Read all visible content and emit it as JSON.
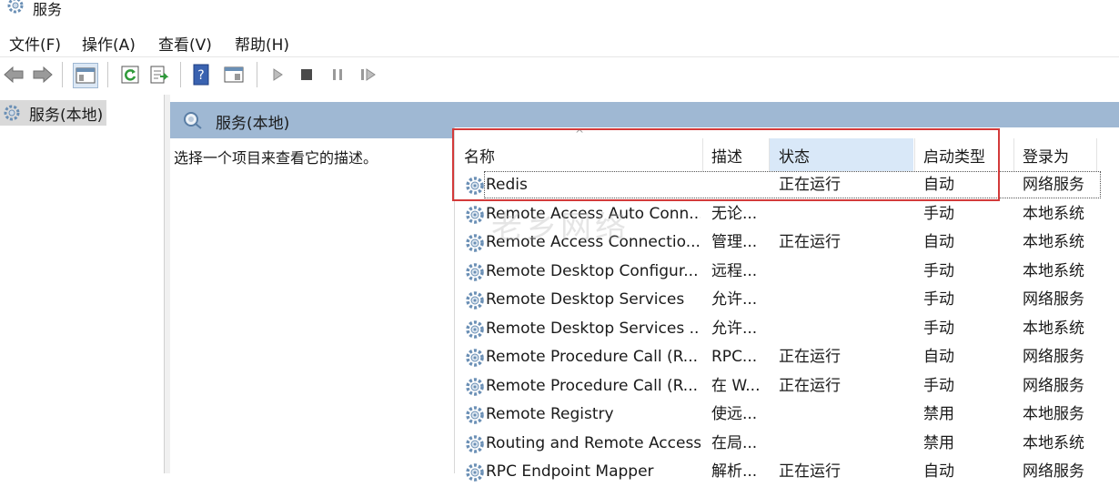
{
  "window": {
    "title": "服务"
  },
  "menu": {
    "items": [
      "文件(F)",
      "操作(A)",
      "查看(V)",
      "帮助(H)"
    ]
  },
  "tree": {
    "item_label": "服务(本地)"
  },
  "panel": {
    "header": "服务(本地)",
    "description": "选择一个项目来查看它的描述。"
  },
  "columns": {
    "name": "名称",
    "desc": "描述",
    "status": "状态",
    "startup": "启动类型",
    "logon": "登录为"
  },
  "rows": [
    {
      "name": "Redis",
      "desc": "",
      "status": "正在运行",
      "startup": "自动",
      "logon": "网络服务"
    },
    {
      "name": "Remote Access Auto Conn...",
      "desc": "无论...",
      "status": "",
      "startup": "手动",
      "logon": "本地系统"
    },
    {
      "name": "Remote Access Connectio...",
      "desc": "管理...",
      "status": "正在运行",
      "startup": "自动",
      "logon": "本地系统"
    },
    {
      "name": "Remote Desktop Configur...",
      "desc": "远程...",
      "status": "",
      "startup": "手动",
      "logon": "本地系统"
    },
    {
      "name": "Remote Desktop Services",
      "desc": "允许...",
      "status": "",
      "startup": "手动",
      "logon": "网络服务"
    },
    {
      "name": "Remote Desktop Services ...",
      "desc": "允许...",
      "status": "",
      "startup": "手动",
      "logon": "本地系统"
    },
    {
      "name": "Remote Procedure Call (R...",
      "desc": "RPC...",
      "status": "正在运行",
      "startup": "自动",
      "logon": "网络服务"
    },
    {
      "name": "Remote Procedure Call (R...",
      "desc": "在 W...",
      "status": "正在运行",
      "startup": "手动",
      "logon": "网络服务"
    },
    {
      "name": "Remote Registry",
      "desc": "使远...",
      "status": "",
      "startup": "禁用",
      "logon": "本地服务"
    },
    {
      "name": "Routing and Remote Access",
      "desc": "在局...",
      "status": "",
      "startup": "禁用",
      "logon": "本地系统"
    },
    {
      "name": "RPC Endpoint Mapper",
      "desc": "解析...",
      "status": "正在运行",
      "startup": "自动",
      "logon": "网络服务"
    }
  ],
  "watermark": "老乡网络",
  "colors": {
    "header_band": "#9fb8d3",
    "sorted_column": "#d9e8f8",
    "highlight_box": "#d33a3a"
  }
}
